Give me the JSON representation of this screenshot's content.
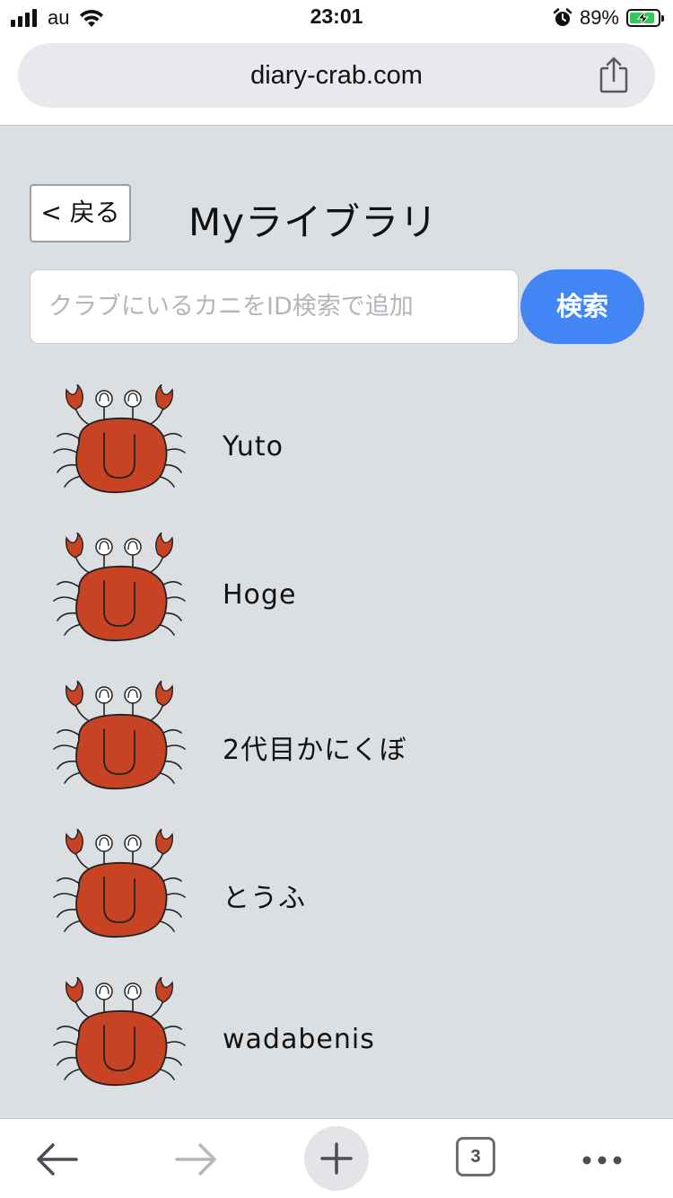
{
  "status_bar": {
    "carrier": "au",
    "time": "23:01",
    "battery_percent_label": "89%",
    "battery_level": 0.89,
    "icons": [
      "signal-icon",
      "wifi-icon",
      "alarm-icon",
      "battery-charging-icon"
    ]
  },
  "browser": {
    "url": "diary-crab.com",
    "share_icon": "share-icon",
    "toolbar": {
      "back_icon": "back-arrow-icon",
      "forward_icon": "forward-arrow-icon",
      "new_tab_icon": "plus-icon",
      "tab_count": "3",
      "more_icon": "more-dots-icon"
    }
  },
  "page": {
    "back_button_label": "< 戻る",
    "title": "Myライブラリ",
    "search": {
      "placeholder": "クラブにいるカニをID検索で追加",
      "value": "",
      "button_label": "検索"
    },
    "members": [
      {
        "name": "Yuto",
        "avatar": "crab-icon"
      },
      {
        "name": "Hoge",
        "avatar": "crab-icon"
      },
      {
        "name": "2代目かにくぼ",
        "avatar": "crab-icon"
      },
      {
        "name": "とうふ",
        "avatar": "crab-icon"
      },
      {
        "name": "wadabenis",
        "avatar": "crab-icon"
      }
    ]
  },
  "colors": {
    "page_background": "#dcdfe2",
    "accent_button": "#4285f4",
    "crab_body": "#c84224",
    "battery_fill": "#34c759"
  }
}
